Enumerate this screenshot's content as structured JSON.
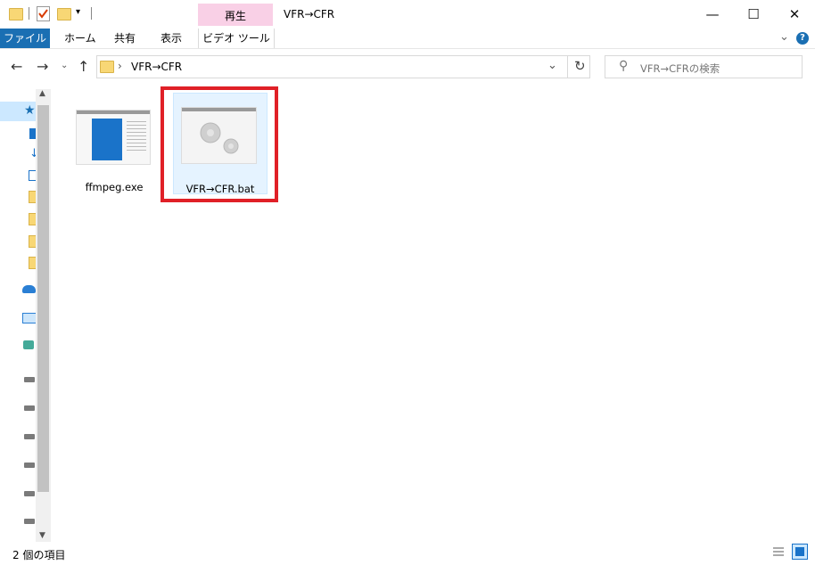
{
  "window": {
    "title": "VFR→CFR",
    "context_tab_group": "再生",
    "minimize": "—",
    "maximize": "☐",
    "close": "✕"
  },
  "ribbon": {
    "tabs": [
      "ファイル",
      "ホーム",
      "共有",
      "表示",
      "ビデオ ツール"
    ],
    "expand": "⌄",
    "help": "?"
  },
  "address": {
    "path": "VFR→CFR",
    "separator": "›",
    "dropdown": "⌄",
    "refresh": "↻"
  },
  "nav": {
    "back": "←",
    "forward": "→",
    "recent": "⌄",
    "up": "↑"
  },
  "search": {
    "placeholder": "VFR→CFRの検索",
    "icon": "⚲"
  },
  "files": [
    {
      "name": "ffmpeg.exe",
      "icon": "exe-window-icon"
    },
    {
      "name": "VFR→CFR.bat",
      "icon": "gears-icon",
      "selected": true
    }
  ],
  "status": {
    "count": "2 個の項目"
  },
  "colors": {
    "file_tab": "#1a6fb3",
    "context_band": "#f9d0e6",
    "highlight": "#e02027"
  }
}
